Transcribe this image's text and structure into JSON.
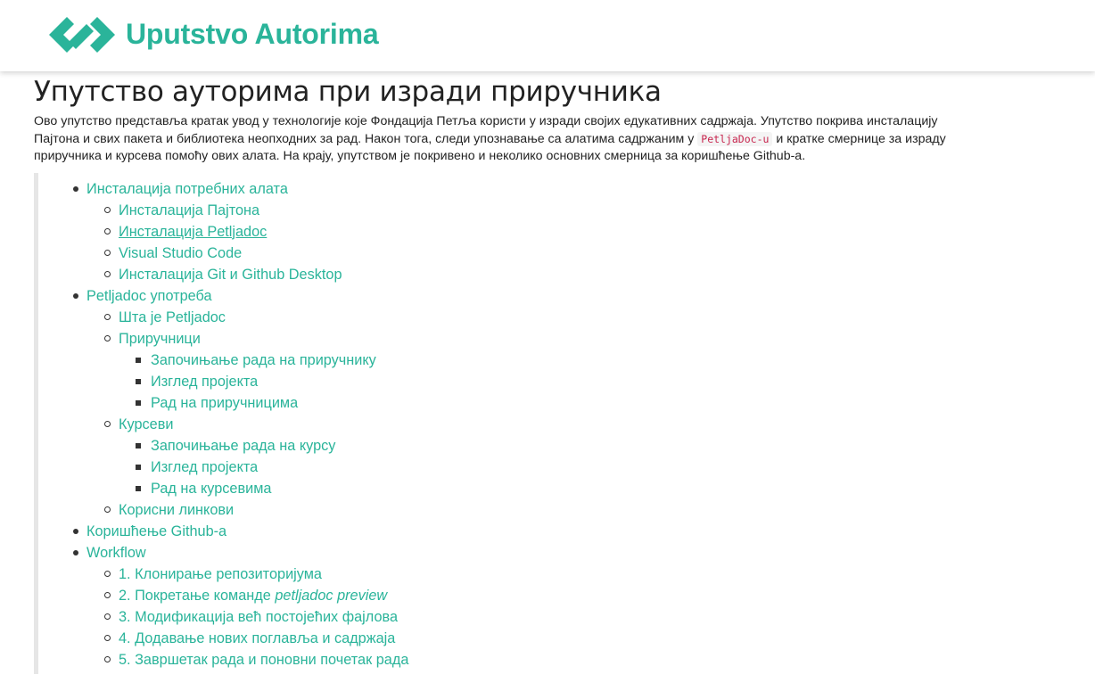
{
  "header": {
    "logo_icon": "petlja-logo-icon",
    "site_title": "Uputstvo Autorima",
    "accent_color": "#2ab49a"
  },
  "page": {
    "title": "Упутство ауторима при изради приручника",
    "intro_part1": "Ово упутство представља кратак увод у технологије које Фондација Петља користи у изради својих едукативних садржаја. Упутство покрива инсталацију Пајтона и свих пакета и библиотека неопходних за рад. Након тога, следи упознавање са алатима садржаним у ",
    "intro_code": "PetljaDoc-u",
    "intro_part2": " и кратке смернице за израду приручника и курсева помоћу ових алата. На крају, упутством је покривено и неколико основних смерница за коришћење Github-а."
  },
  "toc": {
    "installation": {
      "label": "Инсталација потребних алата",
      "items": [
        "Инсталација Пајтона",
        "Инсталација Petljadoc",
        "Visual Studio Code",
        "Инсталација Git и Github Desktop"
      ]
    },
    "usage": {
      "label": "Petljadoc употреба",
      "what_is": "Шта је Petljadoc",
      "manuals": {
        "label": "Приручници",
        "items": [
          "Започињање рада на приручнику",
          "Изглед пројекта",
          "Рад на приручницима"
        ]
      },
      "courses": {
        "label": "Курсеви",
        "items": [
          "Започињање рада на курсу",
          "Изглед пројекта",
          "Рад на курсевима"
        ]
      },
      "useful_links": "Корисни линкови"
    },
    "github": {
      "label": "Коришћење Github-а"
    },
    "workflow": {
      "label": "Workflow",
      "step1": "1. Клонирање репозиторијума",
      "step2_prefix": "2. Покретање команде ",
      "step2_command": "petljadoc preview",
      "step3": "3. Модификација већ постојећих фајлова",
      "step4": "4. Додавање нових поглавља и садржаја",
      "step5": "5. Завршетак рада и поновни почетак рада"
    }
  }
}
